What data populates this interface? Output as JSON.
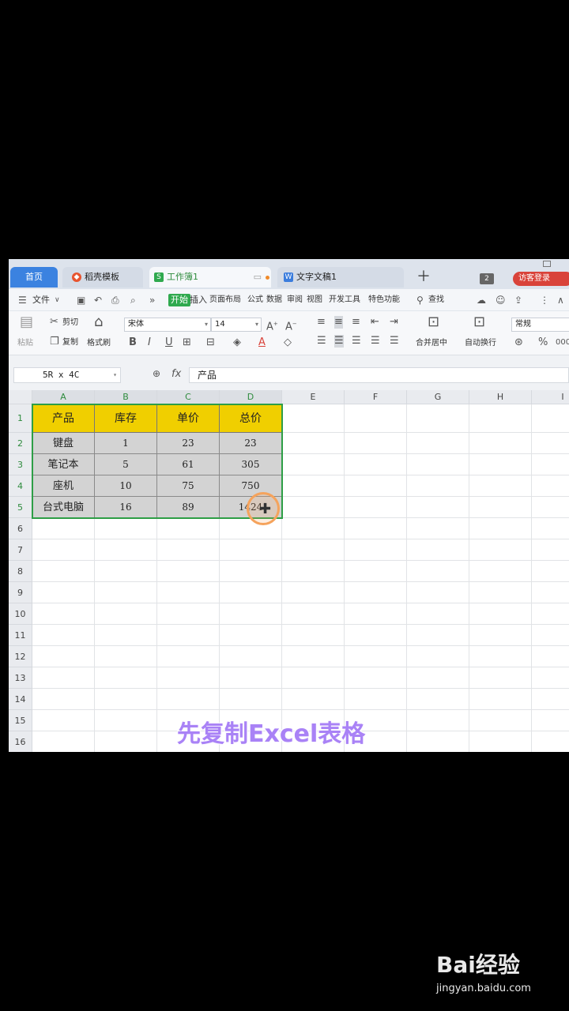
{
  "tabs": {
    "home": "首页",
    "template": "稻壳模板",
    "workbook": "工作簿1",
    "document": "文字文稿1",
    "window_count": "2",
    "login": "访客登录"
  },
  "menu": {
    "file": "文件",
    "items": [
      "开始",
      "插入",
      "页面布局",
      "公式",
      "数据",
      "审阅",
      "视图",
      "开发工具",
      "特色功能"
    ],
    "search": "查找"
  },
  "ribbon": {
    "paste": "粘贴",
    "cut": "剪切",
    "copy": "复制",
    "format_painter": "格式刷",
    "font_name": "宋体",
    "font_size": "14",
    "merge_center": "合并居中",
    "auto_wrap": "自动换行",
    "number_format": "常规"
  },
  "formula_bar": {
    "name_box": "5R x 4C",
    "fx": "fx",
    "content": "产品"
  },
  "grid": {
    "columns": [
      "A",
      "B",
      "C",
      "D",
      "E",
      "F",
      "G",
      "H",
      "I"
    ],
    "rows": [
      "1",
      "2",
      "3",
      "4",
      "5",
      "6",
      "7",
      "8",
      "9",
      "10",
      "11",
      "12",
      "13",
      "14",
      "15",
      "16"
    ],
    "headers": [
      "产品",
      "库存",
      "单价",
      "总价"
    ],
    "data": [
      [
        "键盘",
        "1",
        "23",
        "23"
      ],
      [
        "笔记本",
        "5",
        "61",
        "305"
      ],
      [
        "座机",
        "10",
        "75",
        "750"
      ],
      [
        "台式电脑",
        "16",
        "89",
        "1424"
      ]
    ]
  },
  "caption": "先复制Excel表格",
  "watermark": {
    "logo": "Bai经验",
    "url": "jingyan.baidu.com"
  },
  "colors": {
    "header_fill": "#f0cf00",
    "data_fill": "#d3d3d3",
    "selection_border": "#2e9e46",
    "active_tab": "#2fa94e",
    "home_tab": "#3b82e0",
    "login_button": "#d9433a",
    "caption": "#a982f6"
  }
}
